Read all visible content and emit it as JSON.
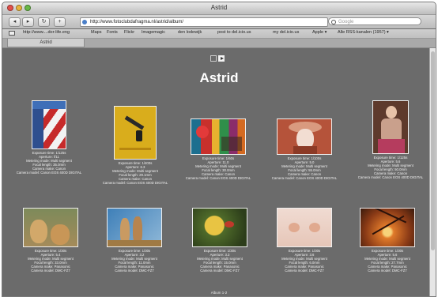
{
  "window": {
    "title": "Astrid"
  },
  "toolbar": {
    "back_glyph": "◂",
    "forward_glyph": "▸",
    "reload_glyph": "↻",
    "add_glyph": "+",
    "url": "http://www.fotoclubdafragma.nl/astrid/album/",
    "search_placeholder": "Google"
  },
  "bookmarks": [
    "http://www....dor-life.eng",
    "Maps",
    "Fonts",
    "Flickr",
    "Imagemagic",
    "den lodewijk",
    "post to del.icio.us",
    "my del.icio.us",
    "Apple ▾",
    "Alle RSS-kanalen (1957) ▾"
  ],
  "tab": {
    "label": "Astrid"
  },
  "album": {
    "title": "Astrid",
    "footer": "Album 1-2"
  },
  "photos": [
    {
      "subject": "red-white-striped-pole",
      "exposure": "Exposure time: 1/125s",
      "aperture": "Aperture: f/11",
      "metering": "Metering mode: Multi segment",
      "focal": "Focal length: 35.0mm",
      "camera": "Camera make: Canon",
      "model": "Camera model: Canon EOS 400D DIGITAL"
    },
    {
      "subject": "yellow-door-with-lock",
      "exposure": "Exposure time: 1/400s",
      "aperture": "Aperture: 6.3",
      "metering": "Metering mode: Multi segment",
      "focal": "Focal length: 29.1mm",
      "camera": "Camera make: Canon",
      "model": "Camera model: Canon EOS 400D DIGITAL"
    },
    {
      "subject": "colorful-market-stall",
      "exposure": "Exposure time: 1/60s",
      "aperture": "Aperture: 11.0",
      "metering": "Metering mode: Multi segment",
      "focal": "Focal length: 30.0mm",
      "camera": "Camera make: Canon",
      "model": "Camera model: Canon EOS 400D DIGITAL"
    },
    {
      "subject": "mannequin-with-hat",
      "exposure": "Exposure time: 1/100s",
      "aperture": "Aperture: 5.0",
      "metering": "Metering mode: Multi segment",
      "focal": "Focal length: 55.0mm",
      "camera": "Camera make: Canon",
      "model": "Camera model: Canon EOS 400D DIGITAL"
    },
    {
      "subject": "seated-woman-portrait",
      "exposure": "Exposure time: 1/125s",
      "aperture": "Aperture: 5.6",
      "metering": "Metering mode: Multi segment",
      "focal": "Focal length: 50.0mm",
      "camera": "Camera make: Canon",
      "model": "Camera model: Canon EOS 400D DIGITAL"
    },
    {
      "subject": "lion-cubs",
      "exposure": "Exposure time: 1/30s",
      "aperture": "Aperture: 5.4",
      "metering": "Metering mode: Multi segment",
      "focal": "Focal length: 33.0mm",
      "camera": "Camera make: Panasonic",
      "model": "Camera model: DMC-FZ7"
    },
    {
      "subject": "meerkats",
      "exposure": "Exposure time: 1/30s",
      "aperture": "Aperture: 3.2",
      "metering": "Metering mode: Multi segment",
      "focal": "Focal length: 11.0mm",
      "camera": "Camera make: Panasonic",
      "model": "Camera model: DMC-FZ7"
    },
    {
      "subject": "bird-in-foliage",
      "exposure": "Exposure time: 1/30s",
      "aperture": "Aperture: 3.3",
      "metering": "Metering mode: Multi segment",
      "focal": "Focal length: 15.0mm",
      "camera": "Camera make: Panasonic",
      "model": "Camera model: DMC-FZ7"
    },
    {
      "subject": "hands-on-fabric",
      "exposure": "Exposure time: 1/30s",
      "aperture": "Aperture: 3.6",
      "metering": "Metering mode: Multi segment",
      "focal": "Focal length: 6.0mm",
      "camera": "Camera make: Panasonic",
      "model": "Camera model: DMC-FZ7"
    },
    {
      "subject": "sunset-through-branches",
      "exposure": "Exposure time: 1/30s",
      "aperture": "Aperture: 5.6",
      "metering": "Metering mode: Multi segment",
      "focal": "Focal length: 27.7mm",
      "camera": "Camera make: Panasonic",
      "model": "Camera model: DMC-FZ7"
    }
  ]
}
